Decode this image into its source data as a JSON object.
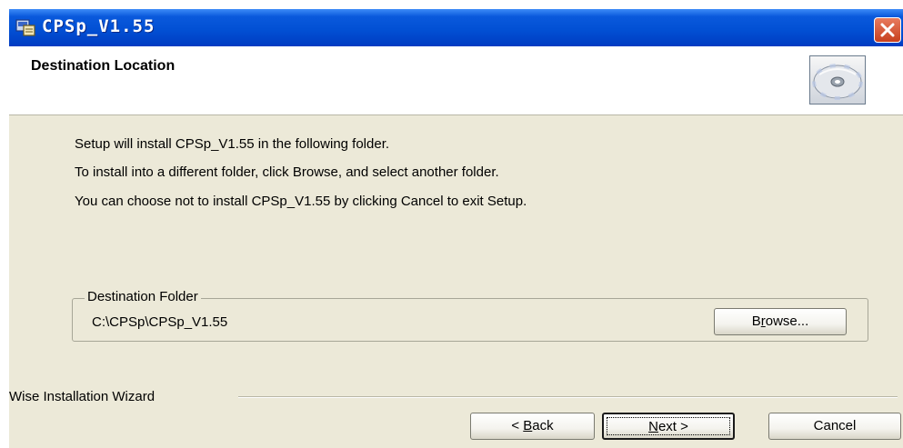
{
  "window": {
    "title": "CPSp_V1.55"
  },
  "header": {
    "title": "Destination Location"
  },
  "body": {
    "lines": [
      "Setup will install CPSp_V1.55 in the following folder.",
      "To install into a different folder, click Browse, and select another folder.",
      "You can choose not to install CPSp_V1.55 by clicking Cancel to exit Setup."
    ]
  },
  "destination": {
    "group_label": "Destination Folder",
    "path": "C:\\CPSp\\CPSp_V1.55",
    "browse_label_prefix": "B",
    "browse_label_mnemonic": "r",
    "browse_label_suffix": "owse..."
  },
  "footer": {
    "wizard_label": "Wise Installation Wizard",
    "back_prefix": "< ",
    "back_mnemonic": "B",
    "back_suffix": "ack",
    "next_mnemonic": "N",
    "next_suffix": "ext >",
    "cancel_label": "Cancel"
  },
  "colors": {
    "titlebar": "#0250d4",
    "dialog_bg": "#ece9d8",
    "close_button": "#d9532f"
  },
  "icons": [
    "installer-app-icon",
    "close-icon",
    "cd-icon"
  ]
}
